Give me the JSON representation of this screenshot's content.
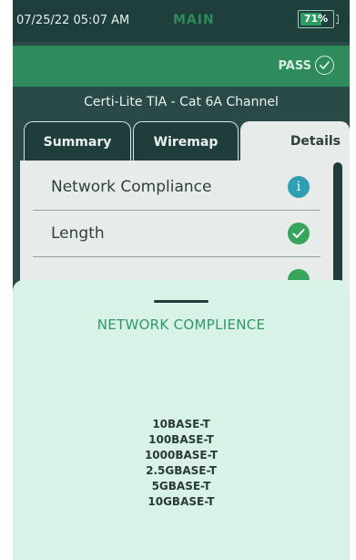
{
  "status_bar": {
    "datetime": "07/25/22 05:07 AM",
    "mode": "MAIN",
    "battery_text": "71%",
    "battery_level": 0.71
  },
  "result": {
    "label": "PASS",
    "icon": "check-circle-icon"
  },
  "test_title": "Certi-Lite TIA - Cat 6A Channel",
  "tabs": [
    {
      "label": "Summary",
      "active": false
    },
    {
      "label": "Wiremap",
      "active": false
    },
    {
      "label": "Details",
      "active": true
    }
  ],
  "details": {
    "rows": [
      {
        "label": "Network Compliance",
        "icon": "info-icon"
      },
      {
        "label": "Length",
        "icon": "check-icon"
      }
    ]
  },
  "sheet": {
    "title": "NETWORK COMPLIENCE",
    "standards": [
      "10BASE-T",
      "100BASE-T",
      "1000BASE-T",
      "2.5GBASE-T",
      "5GBASE-T",
      "10GBASE-T"
    ]
  },
  "colors": {
    "background": "#2a4a48",
    "accent_green": "#2f8a5c",
    "sheet_bg": "#d8f2e8",
    "info_blue": "#2f9fb3"
  }
}
